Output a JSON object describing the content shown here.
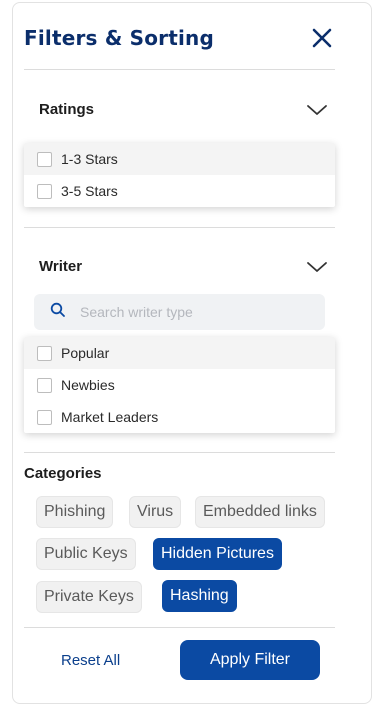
{
  "header": {
    "title": "Filters & Sorting",
    "close_icon": "close-icon"
  },
  "ratings": {
    "label": "Ratings",
    "options": [
      {
        "label": "1-3 Stars",
        "checked": false
      },
      {
        "label": "3-5 Stars",
        "checked": false
      }
    ]
  },
  "writer": {
    "label": "Writer",
    "search_placeholder": "Search writer type",
    "search_value": "",
    "options": [
      {
        "label": "Popular",
        "checked": false
      },
      {
        "label": "Newbies",
        "checked": false
      },
      {
        "label": "Market Leaders",
        "checked": false
      }
    ]
  },
  "categories": {
    "label": "Categories",
    "chips": [
      {
        "label": "Phishing",
        "selected": false
      },
      {
        "label": "Virus",
        "selected": false
      },
      {
        "label": "Embedded links",
        "selected": false
      },
      {
        "label": "Public Keys",
        "selected": false
      },
      {
        "label": "Hidden Pictures",
        "selected": true
      },
      {
        "label": "Private Keys",
        "selected": false
      },
      {
        "label": "Hashing",
        "selected": true
      }
    ]
  },
  "footer": {
    "reset_label": "Reset All",
    "apply_label": "Apply Filter"
  },
  "colors": {
    "primary": "#0b4aa3",
    "title": "#0b2e6b",
    "chip_bg": "#f1f1f1"
  }
}
